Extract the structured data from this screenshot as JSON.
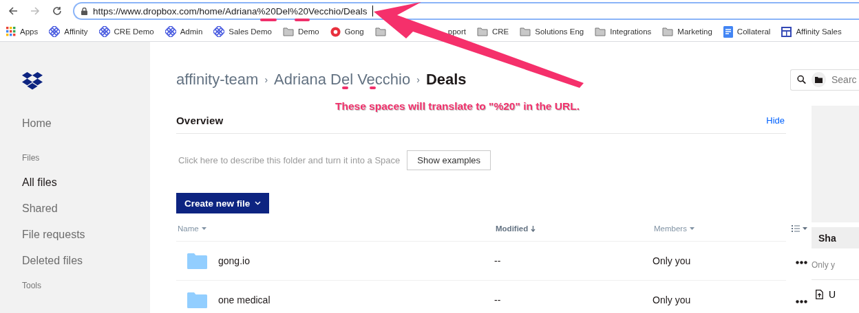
{
  "browser": {
    "url": "https://www.dropbox.com/home/Adriana%20Del%20Vecchio/Deals"
  },
  "bookmarks": [
    {
      "label": "Apps",
      "kind": "apps"
    },
    {
      "label": "Affinity",
      "kind": "affinity"
    },
    {
      "label": "CRE Demo",
      "kind": "affinity"
    },
    {
      "label": "Admin",
      "kind": "affinity"
    },
    {
      "label": "Sales Demo",
      "kind": "affinity"
    },
    {
      "label": "Demo",
      "kind": "folder"
    },
    {
      "label": "Gong",
      "kind": "gong"
    },
    {
      "label": "pport",
      "kind": "folder"
    },
    {
      "label": "CRE",
      "kind": "folder"
    },
    {
      "label": "Solutions Eng",
      "kind": "folder"
    },
    {
      "label": "Integrations",
      "kind": "folder"
    },
    {
      "label": "Marketing",
      "kind": "folder"
    },
    {
      "label": "Collateral",
      "kind": "doc"
    },
    {
      "label": "Affinity Sales",
      "kind": "sheet"
    }
  ],
  "sidebar": {
    "home": "Home",
    "sections": [
      {
        "heading": "Files",
        "items": [
          {
            "label": "All files",
            "selected": true
          },
          {
            "label": "Shared",
            "selected": false
          },
          {
            "label": "File requests",
            "selected": false
          },
          {
            "label": "Deleted files",
            "selected": false
          }
        ]
      },
      {
        "heading": "Tools"
      }
    ]
  },
  "breadcrumb": {
    "separator": "›",
    "items": [
      "affinity-team",
      "Adriana Del Vecchio",
      "Deals"
    ]
  },
  "search": {
    "placeholder": "Searc"
  },
  "annotation": "These spaces will translate to \"%20\" in the URL.",
  "overview": {
    "title": "Overview",
    "hide": "Hide",
    "description": "Click here to describe this folder and turn it into a Space",
    "examples_button": "Show examples"
  },
  "create_button": "Create new file",
  "table": {
    "columns": [
      {
        "label": "Name",
        "sorted": false
      },
      {
        "label": "Modified",
        "sorted": true
      },
      {
        "label": "Members",
        "sorted": false
      }
    ],
    "rows": [
      {
        "name": "gong.io",
        "modified": "--",
        "members": "Only you"
      },
      {
        "name": "one medical",
        "modified": "--",
        "members": "Only you"
      }
    ]
  },
  "side_panel": {
    "share_button": "Sha",
    "note": "Only y",
    "upload": "U"
  }
}
